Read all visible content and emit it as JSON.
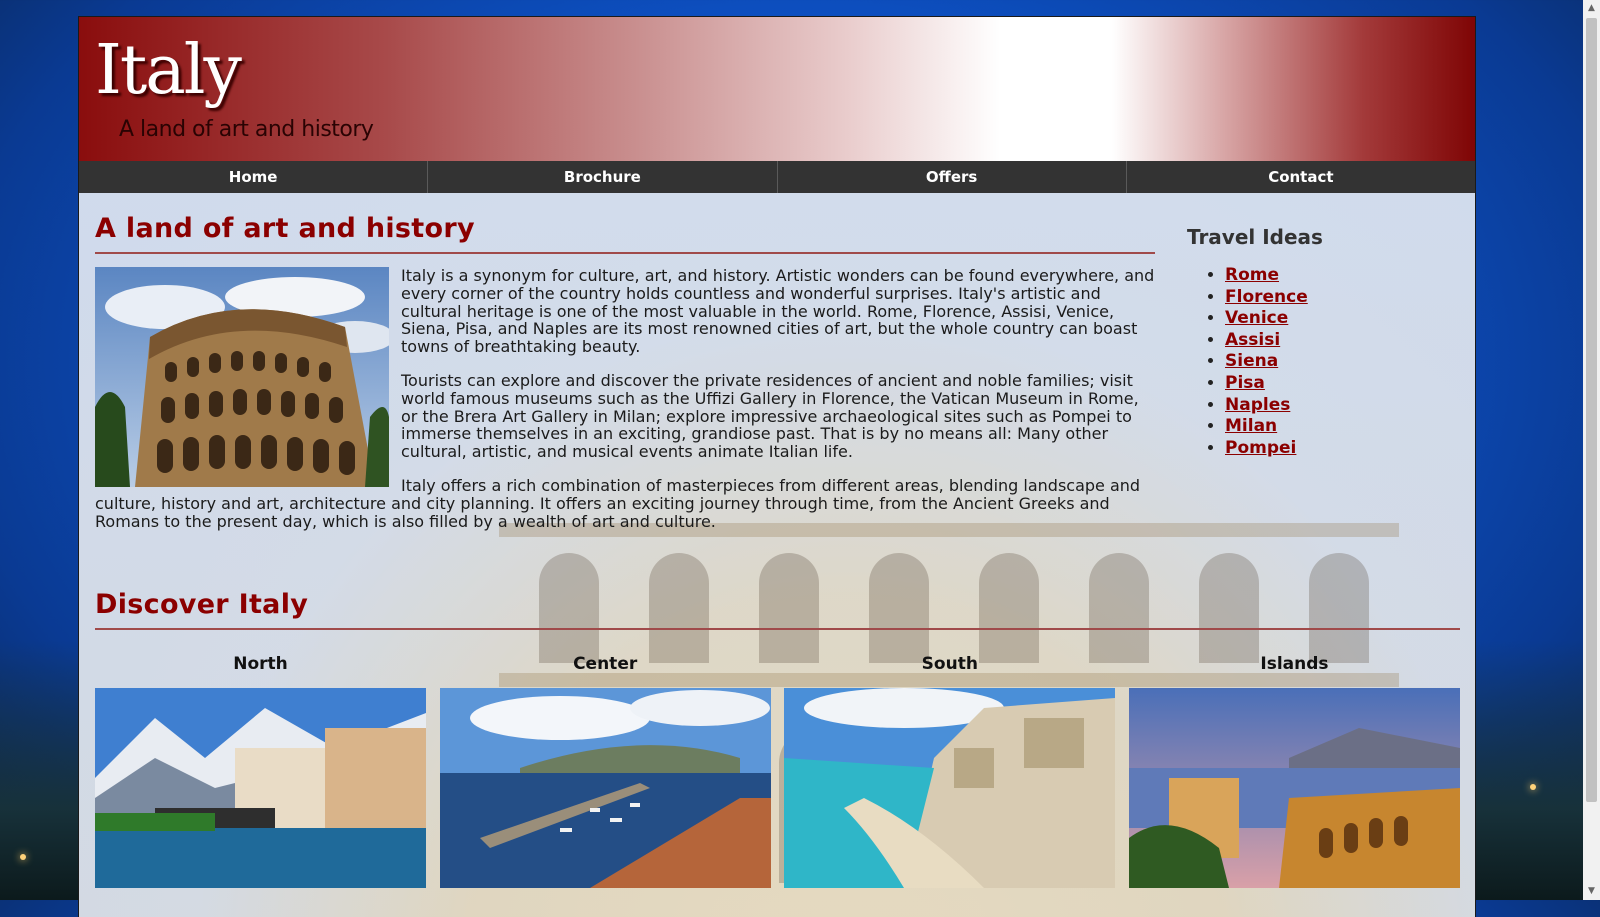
{
  "header": {
    "title": "Italy",
    "tagline": "A land of art and history"
  },
  "nav": {
    "items": [
      "Home",
      "Brochure",
      "Offers",
      "Contact"
    ]
  },
  "main": {
    "heading": "A land of art and history",
    "paragraphs": [
      "Italy is a synonym for culture, art, and history. Artistic wonders can be found everywhere, and every corner of the country holds countless and wonderful surprises. Italy's artistic and cultural heritage is one of the most valuable in the world. Rome, Florence, Assisi, Venice, Siena, Pisa, and Naples are its most renowned cities of art, but the whole country can boast towns of breathtaking beauty.",
      "Tourists can explore and discover the private residences of ancient and noble families; visit world famous museums such as the Uffizi Gallery in Florence, the Vatican Museum in Rome, or the Brera Art Gallery in Milan; explore impressive archaeological sites such as Pompei to immerse themselves in an exciting, grandiose past. That is by no means all: Many other cultural, artistic, and musical events animate Italian life.",
      "Italy offers a rich combination of masterpieces from different areas, blending landscape and culture, history and art, architecture and city planning. It offers an exciting journey through time, from the Ancient Greeks and Romans to the present day, which is also filled by a wealth of art and culture."
    ]
  },
  "sidebar": {
    "heading": "Travel Ideas",
    "links": [
      "Rome",
      "Florence",
      "Venice",
      "Assisi",
      "Siena",
      "Pisa",
      "Naples",
      "Milan",
      "Pompei"
    ]
  },
  "discover": {
    "heading": "Discover Italy",
    "regions": [
      "North",
      "Center",
      "South",
      "Islands"
    ]
  },
  "colors": {
    "brand_red": "#8b0000",
    "nav_bg": "#333333",
    "link": "#8b0000"
  }
}
